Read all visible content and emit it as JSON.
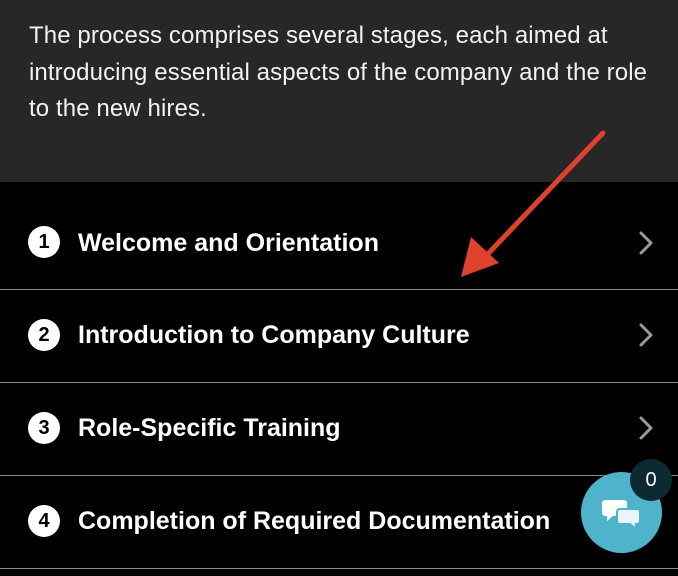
{
  "intro": {
    "text": "The process comprises several stages, each aimed at introducing essential aspects of the company and the role to the new hires."
  },
  "steps": [
    {
      "number": "1",
      "title": "Welcome and Orientation",
      "icon": "chevron-right-icon"
    },
    {
      "number": "2",
      "title": "Introduction to Company Culture",
      "icon": "chevron-right-icon"
    },
    {
      "number": "3",
      "title": "Role-Specific Training",
      "icon": "chevron-right-icon"
    },
    {
      "number": "4",
      "title": "Completion of Required Documentation",
      "icon": "chevron-right-icon"
    }
  ],
  "chat": {
    "badge_count": "0",
    "icon": "chat-bubbles-icon",
    "color": "#4fb3cc"
  },
  "colors": {
    "intro_background": "#272727",
    "list_background": "#000000",
    "annotation_arrow": "#e0402e"
  }
}
